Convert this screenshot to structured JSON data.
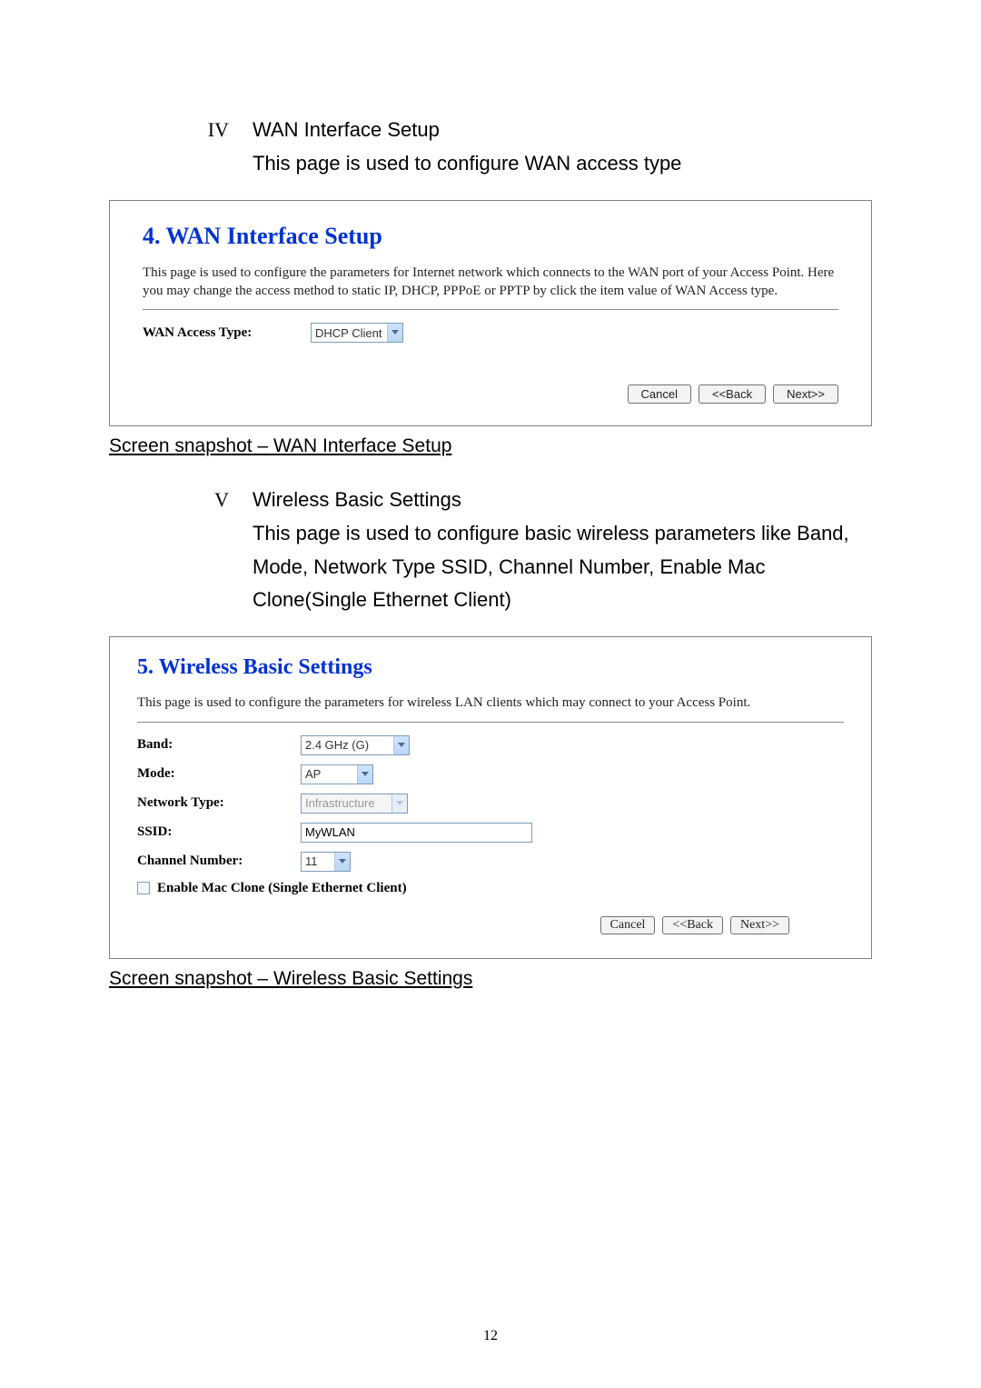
{
  "section_iv": {
    "roman": "IV",
    "title": "WAN Interface Setup",
    "desc": "This page is used to configure WAN access type"
  },
  "panel_wan": {
    "title": "4. WAN Interface Setup",
    "intro": "This page is used to configure the parameters for Internet network which connects to the WAN port of your Access Point. Here you may change the access method to static IP, DHCP, PPPoE or PPTP by click the item value of WAN Access type.",
    "access_label": "WAN Access Type:",
    "access_value": "DHCP Client",
    "buttons": {
      "cancel": "Cancel",
      "back": "<<Back",
      "next": "Next>>"
    }
  },
  "caption_wan": "Screen snapshot – WAN Interface Setup",
  "section_v": {
    "roman": "V",
    "title": "Wireless Basic Settings",
    "desc": "This page is used to configure basic wireless parameters like Band, Mode, Network Type SSID, Channel Number, Enable Mac Clone(Single Ethernet Client)"
  },
  "panel_wireless": {
    "title": "5. Wireless Basic Settings",
    "intro": "This page is used to configure the parameters for wireless LAN clients which may connect to your Access Point.",
    "band_label": "Band:",
    "band_value": "2.4 GHz (G)",
    "mode_label": "Mode:",
    "mode_value": "AP",
    "nettype_label": "Network Type:",
    "nettype_value": "Infrastructure",
    "ssid_label": "SSID:",
    "ssid_value": "MyWLAN",
    "channel_label": "Channel Number:",
    "channel_value": "11",
    "mac_clone_label": "Enable Mac Clone (Single Ethernet Client)",
    "buttons": {
      "cancel": "Cancel",
      "back": "<<Back",
      "next": "Next>>"
    }
  },
  "caption_wireless": "Screen snapshot – Wireless Basic Settings",
  "page_number": "12"
}
